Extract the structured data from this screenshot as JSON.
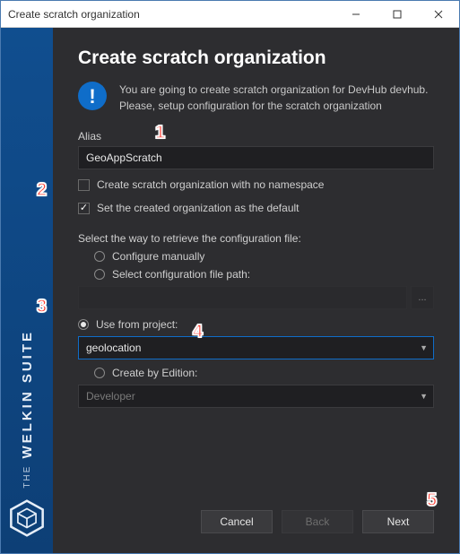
{
  "window": {
    "title": "Create scratch organization"
  },
  "brand": {
    "line_top": "THE",
    "line_main": "WELKIN SUITE"
  },
  "header": {
    "title": "Create scratch organization",
    "intro_line1": "You are going to create scratch organization for DevHub devhub.",
    "intro_line2": "Please, setup configuration for the scratch organization"
  },
  "alias": {
    "label": "Alias",
    "value": "GeoAppScratch"
  },
  "checkboxes": {
    "no_namespace": {
      "label": "Create scratch organization with no namespace",
      "checked": false
    },
    "set_default": {
      "label": "Set the created organization as the default",
      "checked": true
    }
  },
  "retrieve": {
    "heading": "Select the way to retrieve the configuration file:",
    "options": {
      "manual": {
        "label": "Configure manually",
        "selected": false
      },
      "path": {
        "label": "Select configuration file path:",
        "selected": false,
        "value": ""
      },
      "project": {
        "label": "Use from project:",
        "selected": true,
        "value": "geolocation"
      },
      "edition": {
        "label": "Create by Edition:",
        "selected": false,
        "value": "Developer"
      }
    },
    "browse_btn": "..."
  },
  "buttons": {
    "cancel": "Cancel",
    "back": "Back",
    "next": "Next"
  },
  "annotations": {
    "n1": "1",
    "n2": "2",
    "n3": "3",
    "n4": "4",
    "n5": "5"
  }
}
